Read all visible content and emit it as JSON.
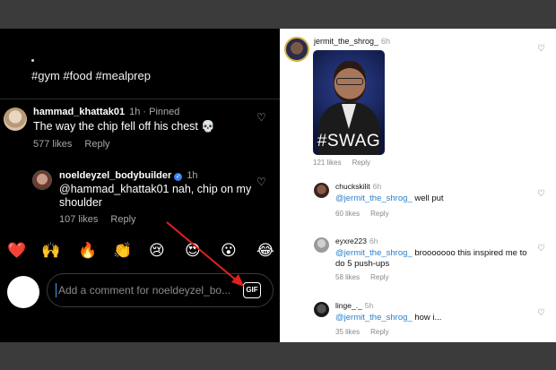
{
  "left_panel": {
    "hashtags": "#gym #food #mealprep",
    "comment1": {
      "username": "hammad_khattak01",
      "meta": "1h · Pinned",
      "text": "The way the chip fell off his chest 💀",
      "likes": "577 likes",
      "reply": "Reply"
    },
    "comment2": {
      "username": "noeldeyzel_bodybuilder",
      "time": "1h",
      "text": "@hammad_khattak01 nah, chip on my shoulder",
      "likes": "107 likes",
      "reply": "Reply"
    },
    "emojis": [
      "❤️",
      "🙌",
      "🔥",
      "👏",
      "😢",
      "😍",
      "😮",
      "😂"
    ],
    "composer": {
      "placeholder": "Add a comment for noeldeyzel_bo...",
      "gif_label": "GIF"
    }
  },
  "right_panel": {
    "post": {
      "username": "jermit_the_shrog_",
      "time": "6h",
      "image_caption": "#SWAG",
      "likes": "121 likes",
      "reply": "Reply"
    },
    "comments": [
      {
        "username": "chuckskilit",
        "time": "6h",
        "mention": "@jermit_the_shrog_",
        "text": " well put",
        "likes": "60 likes",
        "reply": "Reply"
      },
      {
        "username": "eyxre223",
        "time": "6h",
        "mention": "@jermit_the_shrog_",
        "text": " brooooooo this inspired me to do 5 push-ups",
        "likes": "58 likes",
        "reply": "Reply"
      },
      {
        "username": "linge_._",
        "time": "5h",
        "mention": "@jermit_the_shrog_",
        "text": " how i...",
        "likes": "35 likes",
        "reply": "Reply"
      }
    ]
  },
  "colors": {
    "mention": "#2a7fc9",
    "verified": "#3b82f6",
    "arrow": "#e02020"
  }
}
